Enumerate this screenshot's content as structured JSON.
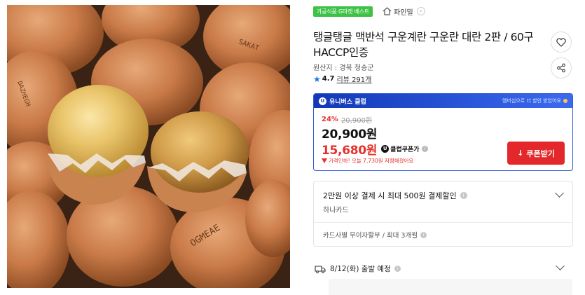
{
  "photo": {
    "alt_stamps": [
      "SAKAT",
      "DAZHEGH",
      "OGMEAE"
    ]
  },
  "badge": {
    "label": "가공식품 G마켓 베스트",
    "color": "#3ec246"
  },
  "store": {
    "name": "파인밀",
    "icon": "house-icon"
  },
  "product": {
    "title_line1": "탱글탱글 맥반석 구운계란 구운란 대란 2판 / 60구",
    "title_line2": "HACCP인증",
    "origin": "원산지 : 경북 청송군",
    "rating": "4.7",
    "reviews": "리뷰 291개"
  },
  "price": {
    "club_label": "유니버스 클럽",
    "club_promo": "멤버십으로 더 할인 받았어요",
    "discount_rate": "24%",
    "original_price": "20,900원",
    "sale_price": "20,900원",
    "club_price": "15,680원",
    "club_price_label": "클럽쿠폰가",
    "lowest_note": "가격인하! 오늘 7,730원 저렴해졌어요",
    "coupon_button": "쿠폰받기",
    "accent": "#e3272a",
    "club_color": "#1238b6"
  },
  "card_benefit": {
    "title": "2만원 이상 결제 시 최대 500원 결제할인",
    "card": "하나카드",
    "installment": "카드사별 무이자할부 / 최대 3개월"
  },
  "shipping": {
    "label": "8/12(화) 출발 예정"
  }
}
